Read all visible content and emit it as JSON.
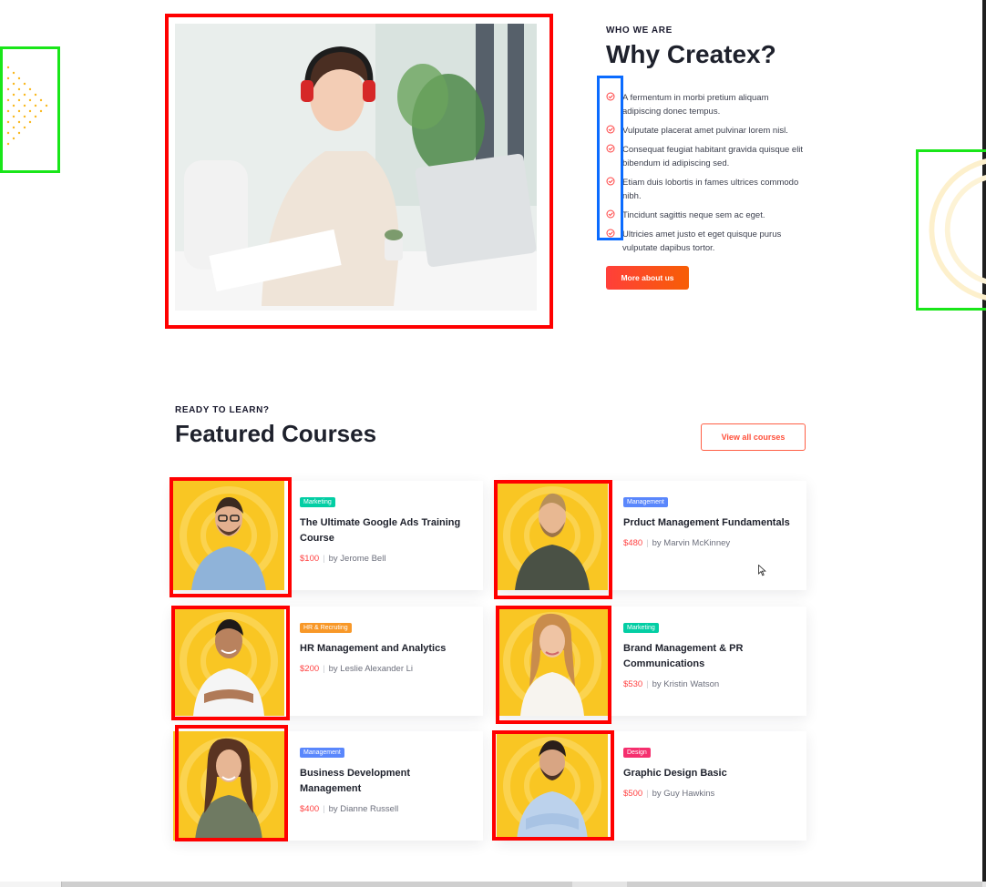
{
  "why": {
    "eyebrow": "WHO WE ARE",
    "title": "Why Createx?",
    "items": [
      {
        "text": "A fermentum in morbi pretium aliquam adipiscing donec tempus."
      },
      {
        "text": "Vulputate placerat amet pulvinar lorem nisl."
      },
      {
        "text": "Consequat feugiat habitant gravida quisque elit bibendum id adipiscing sed."
      },
      {
        "text": "Etiam duis lobortis in fames ultrices commodo nibh."
      },
      {
        "text": "Tincidunt sagittis neque sem ac eget."
      },
      {
        "text": "Ultricies amet justo et eget quisque purus vulputate dapibus tortor."
      }
    ],
    "button_label": "More about us"
  },
  "courses": {
    "eyebrow": "READY TO LEARN?",
    "title": "Featured Courses",
    "view_all_label": "View all courses",
    "list": [
      {
        "category": "Marketing",
        "category_color": "#03cea4",
        "title": "The Ultimate Google Ads Training Course",
        "price": "$100",
        "author": "by Jerome Bell"
      },
      {
        "category": "Management",
        "category_color": "#5a87fc",
        "title": "Prduct Management Fundamentals",
        "price": "$480",
        "author": "by Marvin McKinney"
      },
      {
        "category": "HR & Recruting",
        "category_color": "#f89828",
        "title": "HR  Management and Analytics",
        "price": "$200",
        "author": "by Leslie Alexander Li"
      },
      {
        "category": "Marketing",
        "category_color": "#03cea4",
        "title": "Brand Management & PR Communications",
        "price": "$530",
        "author": "by Kristin Watson"
      },
      {
        "category": "Management",
        "category_color": "#5a87fc",
        "title": "Business Development Management",
        "price": "$400",
        "author": "by Dianne Russell"
      },
      {
        "category": "Design",
        "category_color": "#f52f6e",
        "title": "Graphic Design Basic",
        "price": "$500",
        "author": "by Guy Hawkins"
      }
    ]
  },
  "colors": {
    "accent": "#ff4242",
    "button_gradient_start": "#ff3f3a",
    "button_gradient_end": "#f75e05",
    "image_background": "#f9c623",
    "highlight_frame_red": "#ff0000",
    "highlight_frame_green": "#19e619",
    "highlight_frame_blue": "#0a6bff"
  },
  "icons": {
    "check": "check-circle-icon",
    "cursor": "mouse-pointer-icon"
  }
}
